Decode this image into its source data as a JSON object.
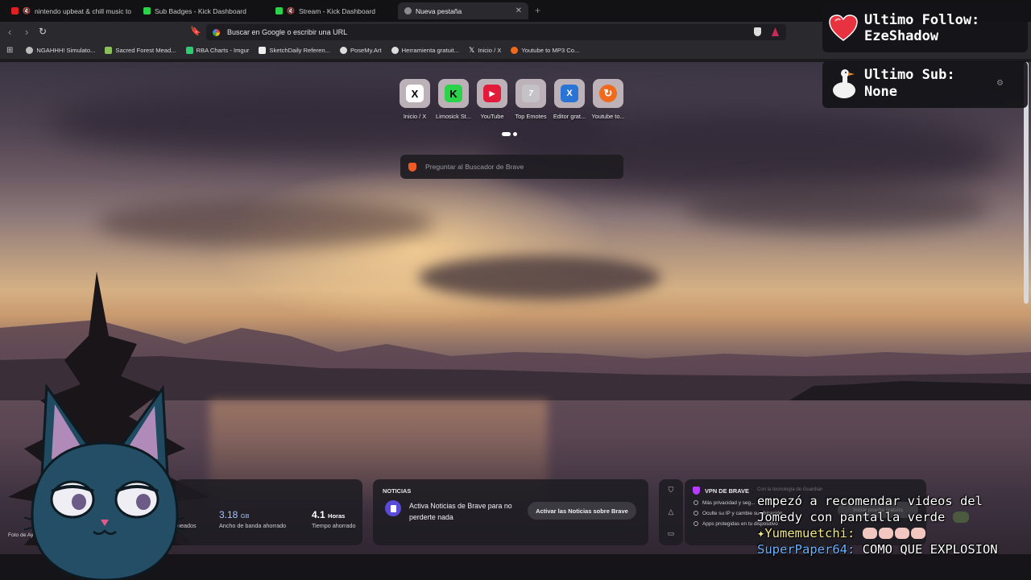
{
  "tabs": [
    {
      "label": "nintendo upbeat & chill music to",
      "favicon": "youtube",
      "muted": true
    },
    {
      "label": "Sub Badges - Kick Dashboard",
      "favicon": "kick"
    },
    {
      "label": "Stream - Kick Dashboard",
      "favicon": "kick",
      "muted": true
    },
    {
      "label": "Nueva pestaña",
      "favicon": "brave",
      "active": true
    }
  ],
  "address_bar": {
    "placeholder": "Buscar en Google o escribir una URL"
  },
  "bookmarks": [
    {
      "label": "NGAHHH! Simulato...",
      "icon": "globe-icon"
    },
    {
      "label": "Sacred Forest Mead...",
      "icon": "leaf-icon"
    },
    {
      "label": "RBA Charts - Imgur",
      "icon": "imgur-icon"
    },
    {
      "label": "SketchDaily Referen...",
      "icon": "sketch-icon"
    },
    {
      "label": "PoseMy.Art",
      "icon": "pose-icon"
    },
    {
      "label": "Herramienta gratuit...",
      "icon": "tool-icon"
    },
    {
      "label": "Inicio / X",
      "icon": "x-icon"
    },
    {
      "label": "Youtube to MP3 Co...",
      "icon": "convert-icon"
    }
  ],
  "top_sites": [
    {
      "label": "Inicio / X",
      "glyph": "X",
      "color": "#ffffff",
      "fg": "#000000"
    },
    {
      "label": "Limosick St...",
      "glyph": "K",
      "color": "#2bd34b",
      "fg": "#000000"
    },
    {
      "label": "YouTube",
      "glyph": "▶",
      "color": "#e31b3b",
      "fg": "#ffffff"
    },
    {
      "label": "Top Emotes",
      "glyph": "7tv",
      "color": "#cfcfd2",
      "fg": "#ffffff"
    },
    {
      "label": "Editor grat...",
      "glyph": "X",
      "color": "#2a74d6",
      "fg": "#ffffff"
    },
    {
      "label": "Youtube to...",
      "glyph": "↻",
      "color": "#f06a1d",
      "fg": "#ffffff"
    }
  ],
  "brave_search": {
    "placeholder": "Preguntar al Buscador de Brave"
  },
  "stats": {
    "bandwidth_value": "3.18",
    "bandwidth_unit": "GB",
    "bandwidth_label": "Ancho de banda ahorrado",
    "time_value": "4.1",
    "time_unit": "Horas",
    "time_label": "Tiempo ahorrado",
    "blocked_label_fragment": "ueados"
  },
  "news": {
    "title": "NOTICIAS",
    "text": "Activa Noticias de Brave para no perderte nada",
    "button": "Activar las Noticias sobre Brave"
  },
  "vpn": {
    "title": "VPN DE BRAVE",
    "powered": "Con la tecnología de Guardian",
    "lines": [
      "Más privacidad y seg...",
      "Oculte su IP y cambie su ubicación",
      "Apps protegidas en tu dispositivo"
    ],
    "button": "Iniciar prueba gratuita"
  },
  "photo_credit": "Foto de Aye",
  "overlay": {
    "follow_title": "Ultimo Follow:",
    "follow_value": "EzeShadow",
    "sub_title": "Ultimo Sub:",
    "sub_value": "None"
  },
  "chat": {
    "line1": "empezó a recomendar videos del",
    "line2": "Jomedy con pantalla verde",
    "msg2_user": "✦Yumemuetchi:",
    "msg3_user": "SuperPaper64:",
    "msg3_text": "COMO QUE EXPLOSION"
  }
}
